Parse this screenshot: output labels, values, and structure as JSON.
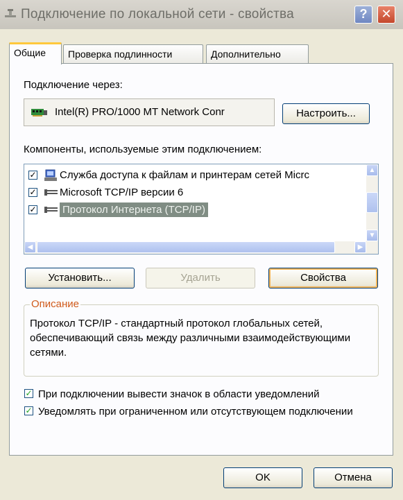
{
  "window": {
    "title": "Подключение по локальной сети - свойства",
    "help_label": "?",
    "close_label": "✕"
  },
  "tabs": [
    {
      "label": "Общие",
      "active": true
    },
    {
      "label": "Проверка подлинности",
      "active": false
    },
    {
      "label": "Дополнительно",
      "active": false
    }
  ],
  "general": {
    "connect_via_label": "Подключение через:",
    "adapter_name": "Intel(R) PRO/1000 MT Network Conr",
    "configure_button": "Настроить...",
    "components_label": "Компоненты, используемые этим подключением:",
    "components": [
      {
        "label": "Служба доступа к файлам и принтерам сетей Micrc",
        "checked": true,
        "icon": "file-printer-sharing-icon",
        "selected": false
      },
      {
        "label": "Microsoft TCP/IP версии 6",
        "checked": true,
        "icon": "network-protocol-icon",
        "selected": false
      },
      {
        "label": "Протокол Интернета (TCP/IP)",
        "checked": true,
        "icon": "network-protocol-icon",
        "selected": true
      }
    ],
    "install_button": "Установить...",
    "remove_button": "Удалить",
    "properties_button": "Свойства",
    "description_title": "Описание",
    "description_text": "Протокол TCP/IP - стандартный протокол глобальных сетей, обеспечивающий связь между различными взаимодействующими сетями.",
    "option_show_icon": "При подключении вывести значок в области уведомлений",
    "option_notify": "Уведомлять при ограниченном или отсутствующем подключении"
  },
  "footer": {
    "ok_button": "OK",
    "cancel_button": "Отмена"
  },
  "colors": {
    "check_green": "#21a121",
    "selection": "#808d84",
    "group_title": "#d05a1a"
  }
}
